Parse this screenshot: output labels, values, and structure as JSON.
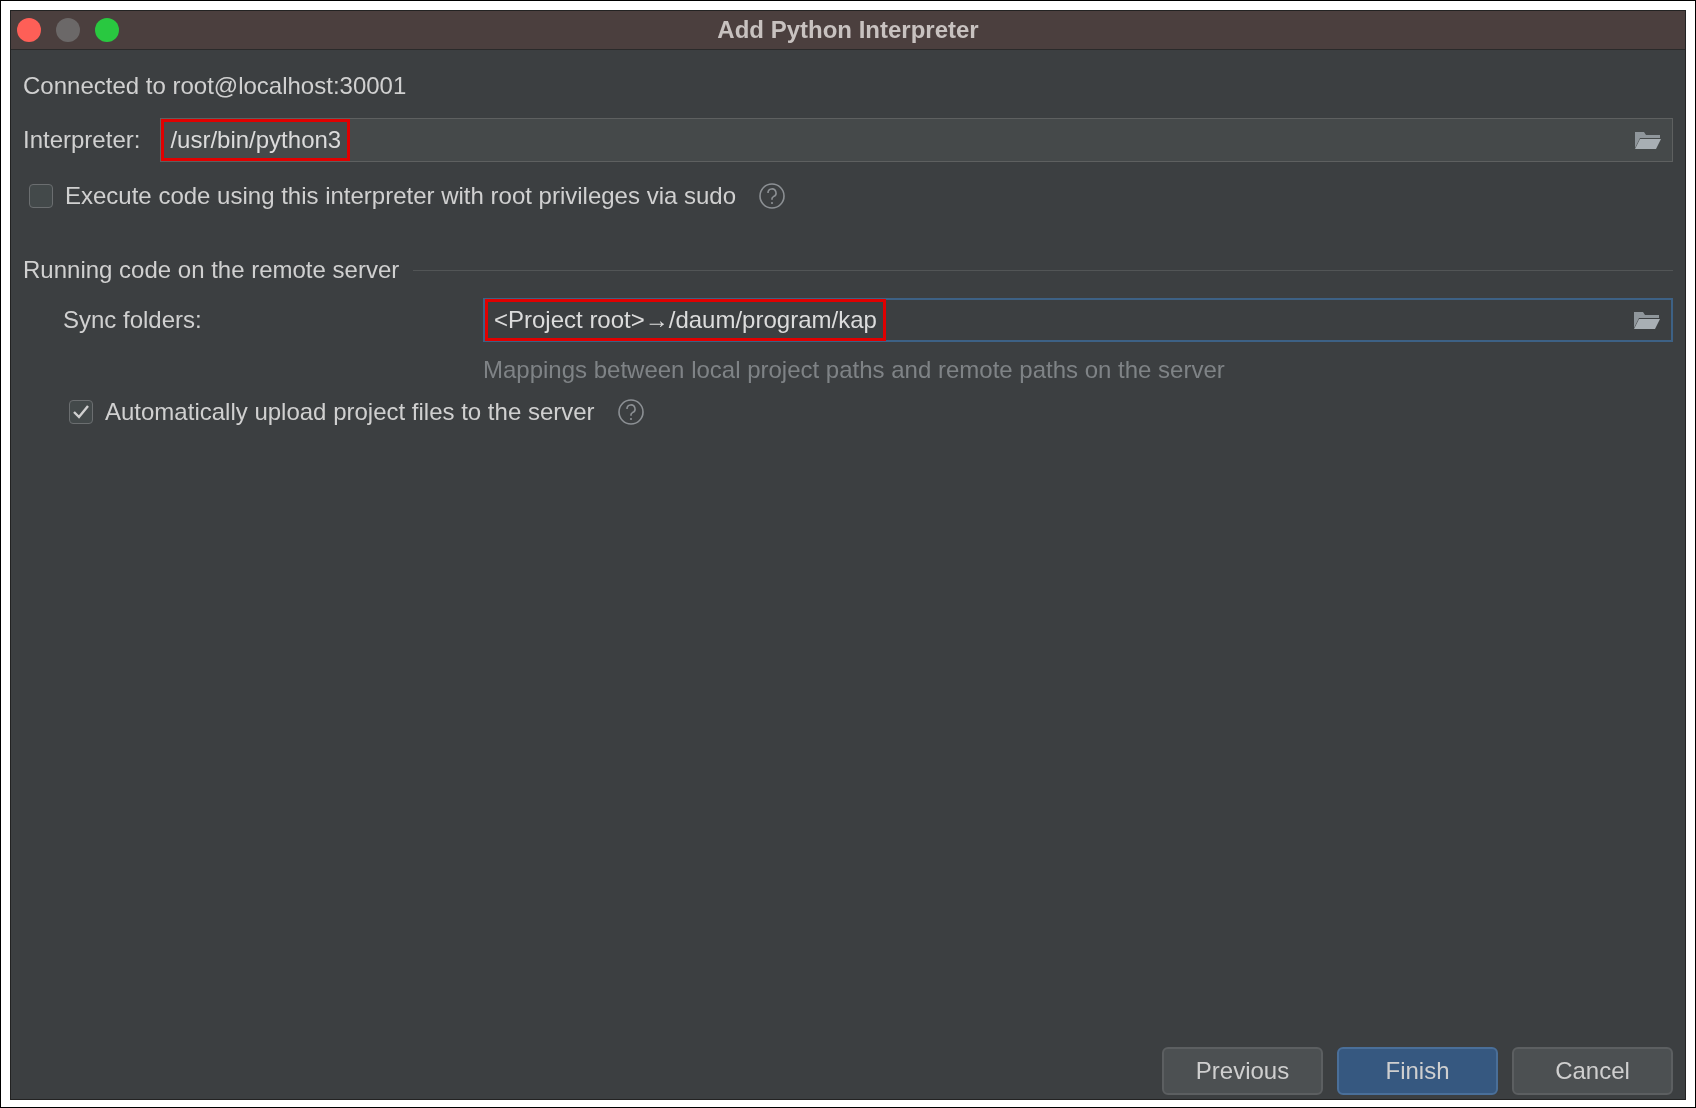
{
  "window": {
    "title": "Add Python Interpreter"
  },
  "connection": "Connected to root@localhost:30001",
  "interpreter": {
    "label": "Interpreter:",
    "value": "/usr/bin/python3",
    "highlighted": true,
    "focused": false
  },
  "sudo": {
    "label": "Execute code using this interpreter with root privileges via sudo",
    "checked": false
  },
  "section": {
    "title": "Running code on the remote server",
    "sync": {
      "label": "Sync folders:",
      "value": "<Project root>→/daum/program/kap",
      "highlighted": true,
      "focused": true
    },
    "hint": "Mappings between local project paths and remote paths on the server",
    "upload": {
      "label": "Automatically upload project files to the server",
      "checked": true
    }
  },
  "buttons": [
    {
      "label": "Previous",
      "default": false
    },
    {
      "label": "Finish",
      "default": true
    },
    {
      "label": "Cancel",
      "default": false
    }
  ]
}
